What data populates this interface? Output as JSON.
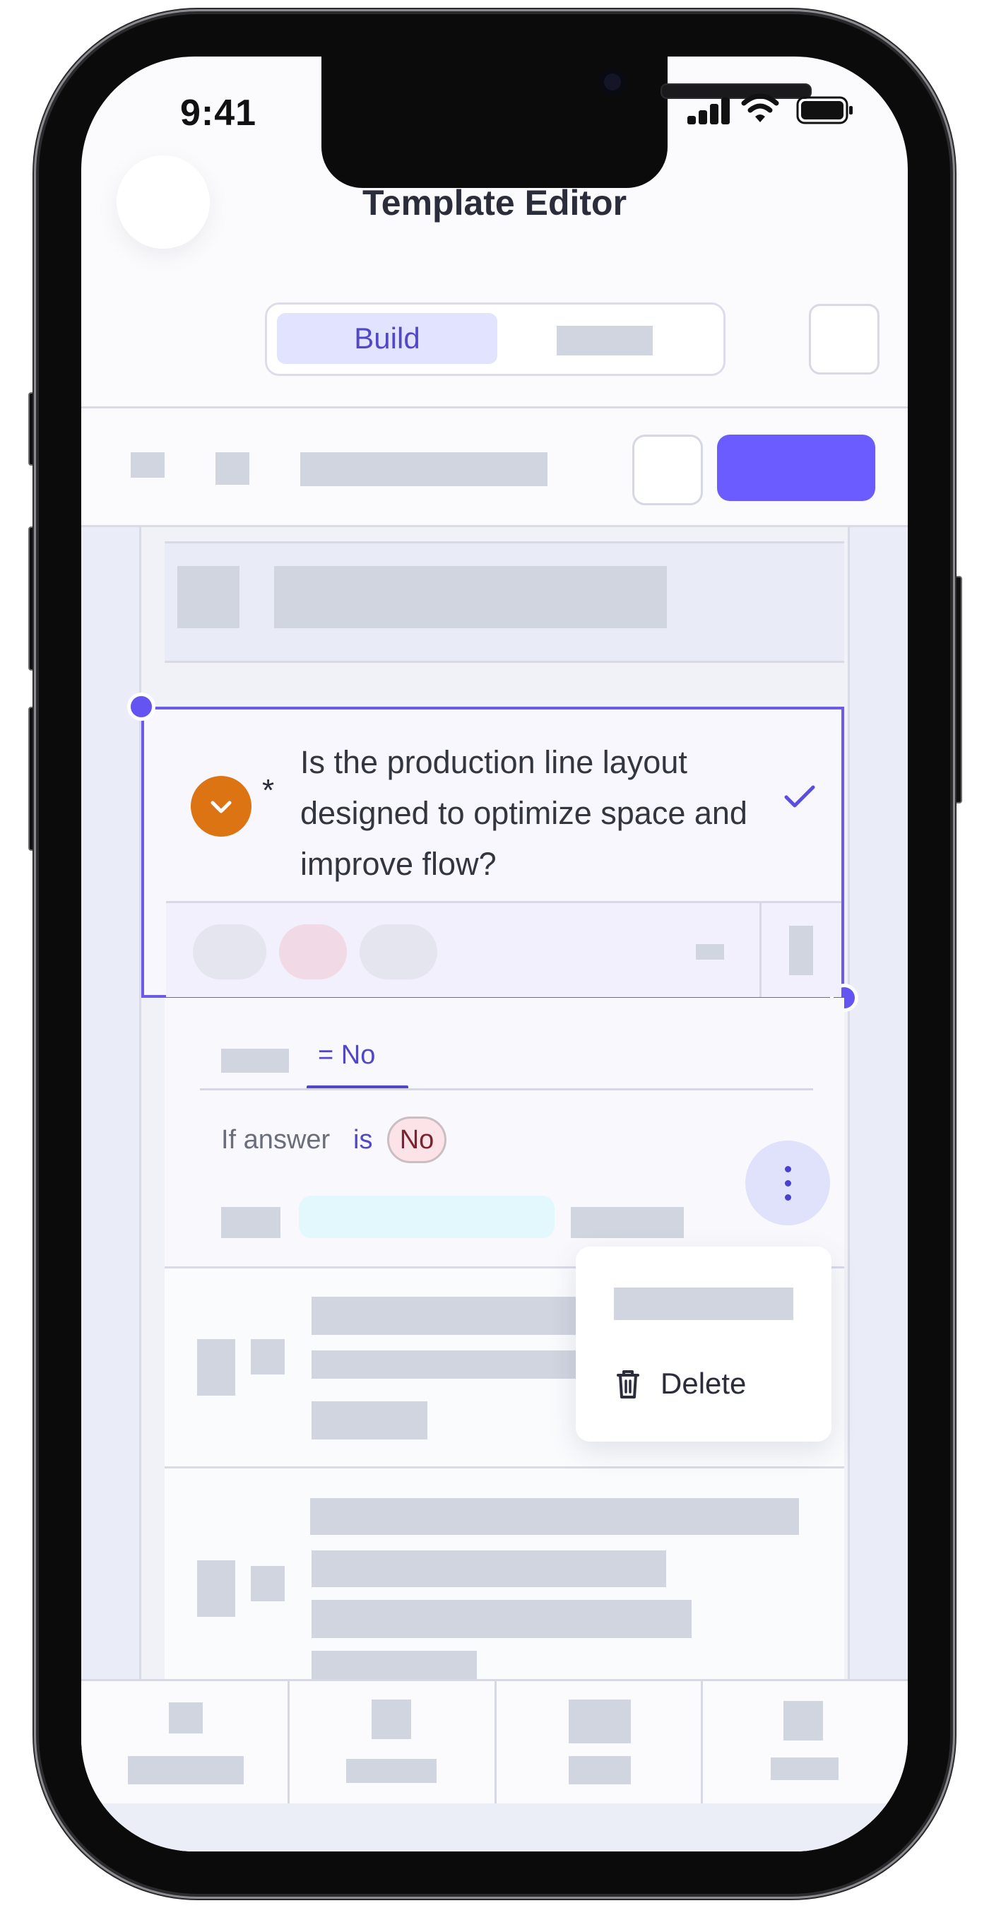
{
  "status_bar": {
    "time": "9:41"
  },
  "header": {
    "title": "Template Editor"
  },
  "segmented_control": {
    "active_label": "Build"
  },
  "question": {
    "required_marker": "*",
    "text": "Is the production line layout designed to optimize space and improve flow?"
  },
  "logic": {
    "condition_tab_label": "= No",
    "rule_prefix": "If answer",
    "rule_operator": "is",
    "rule_value": "No"
  },
  "context_menu": {
    "delete_label": "Delete"
  },
  "colors": {
    "accent": "#6a5cff",
    "selection_border": "#6b5be6",
    "badge_orange": "#dd7414",
    "negative_chip": "#fbe3e8"
  },
  "icons": [
    "chevron-down-icon",
    "check-icon",
    "more-vertical-icon",
    "trash-icon",
    "signal-icon",
    "wifi-icon",
    "battery-icon"
  ]
}
